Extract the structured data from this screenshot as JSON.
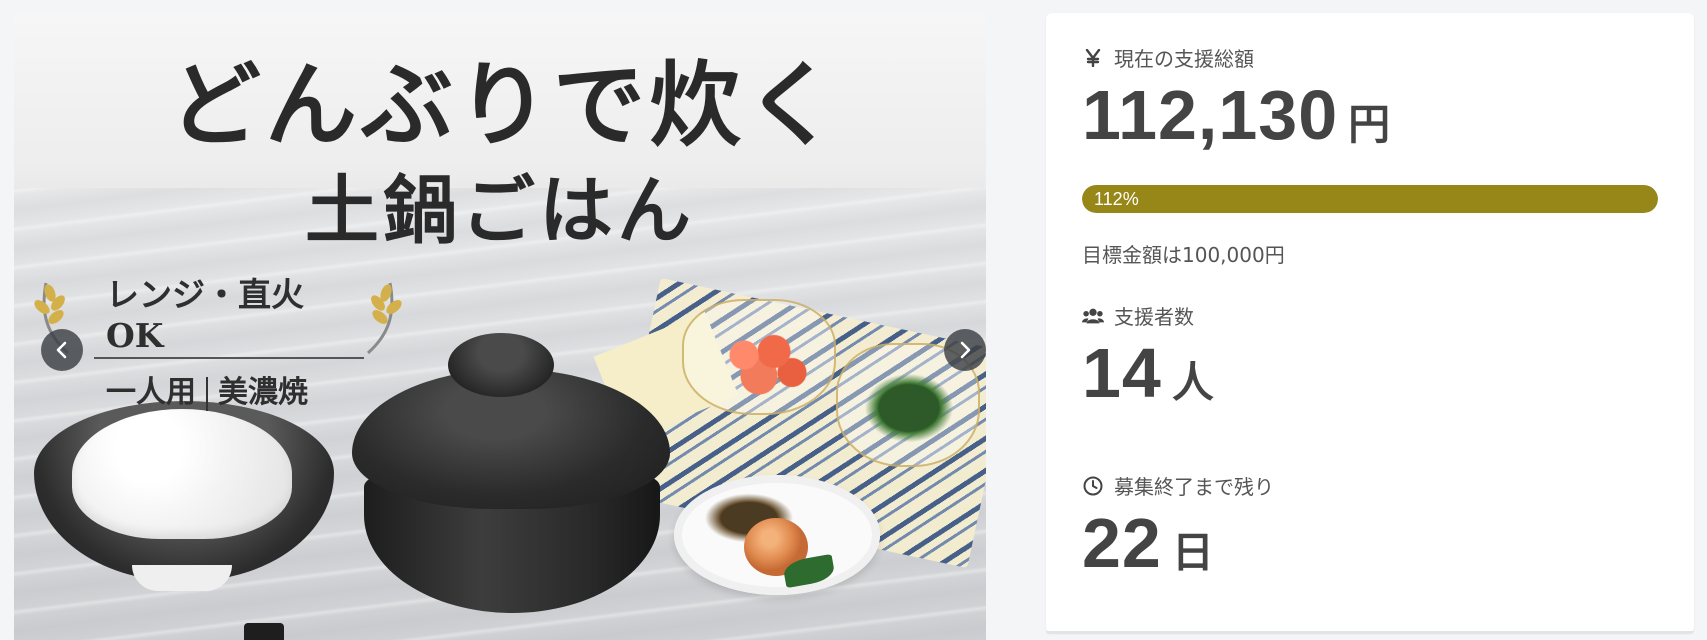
{
  "hero": {
    "title_line1": "どんぶりで炊く",
    "title_line2": "土鍋ごはん",
    "badge_line1": "レンジ・直火OK",
    "badge_line2_left": "一人用",
    "badge_line2_right": "美濃焼",
    "prev_icon": "chevron-left-icon",
    "next_icon": "chevron-right-icon"
  },
  "stats": {
    "total": {
      "icon": "yen-icon",
      "label": "現在の支援総額",
      "value": "112,130",
      "unit": "円"
    },
    "progress": {
      "percent": 112,
      "label": "112%",
      "color": "#978718"
    },
    "goal_text": "目標金額は100,000円",
    "backers": {
      "icon": "users-icon",
      "label": "支援者数",
      "value": "14",
      "unit": "人"
    },
    "remaining": {
      "icon": "clock-icon",
      "label": "募集終了まで残り",
      "value": "22",
      "unit": "日"
    }
  }
}
